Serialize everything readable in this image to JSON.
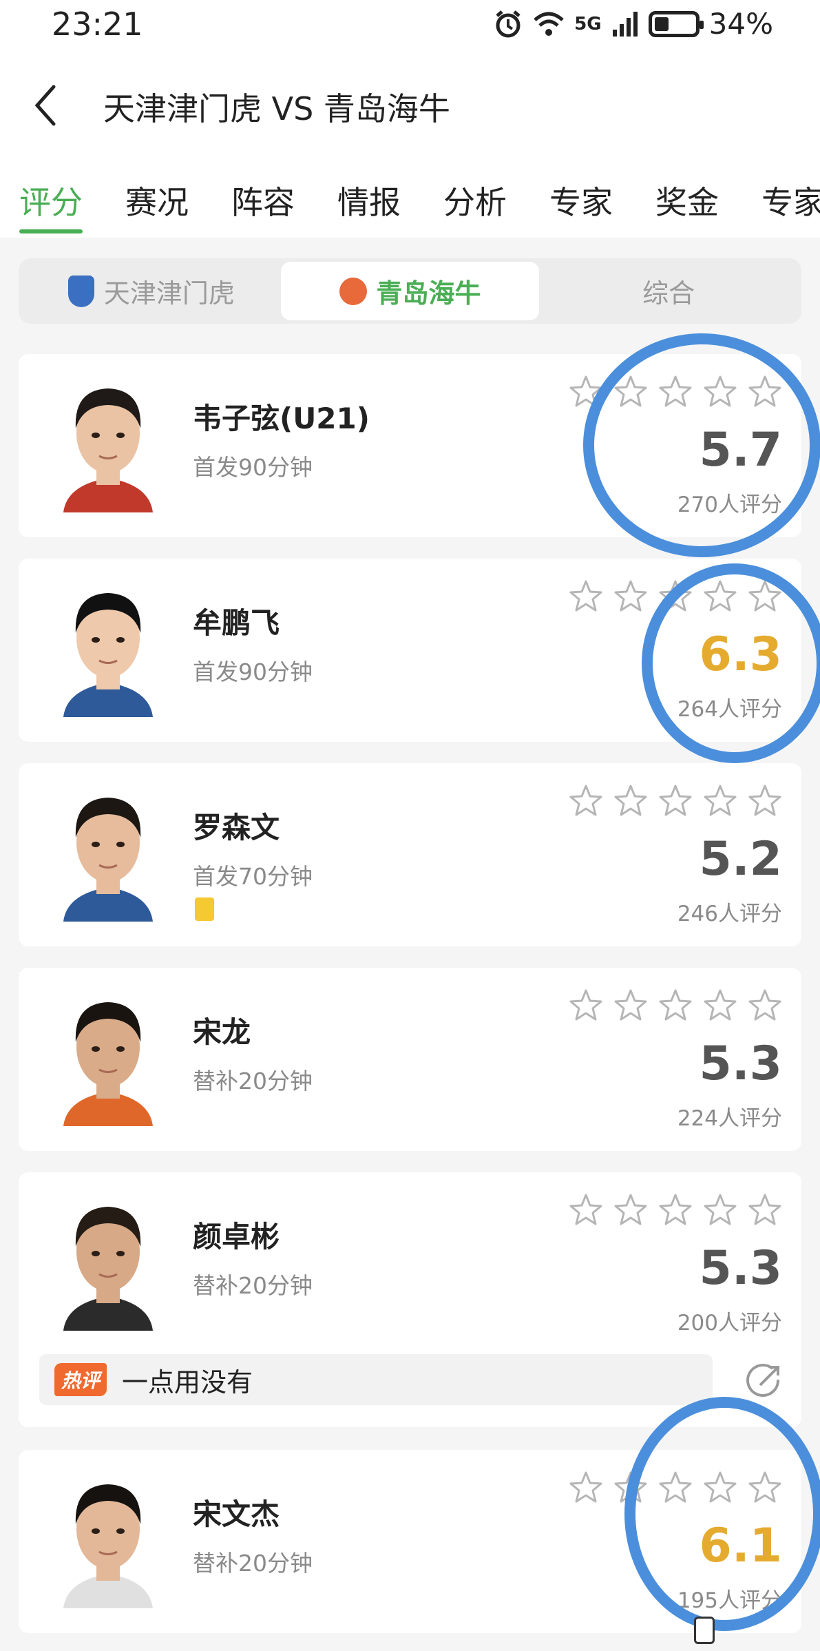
{
  "status_bar": {
    "time": "23:21",
    "network": "5G",
    "battery": "34%",
    "icons": [
      "alarm-icon",
      "wifi-icon",
      "signal-icon",
      "battery-icon"
    ]
  },
  "header": {
    "title": "天津津门虎 VS 青岛海牛",
    "back_icon": "chevron-left-icon"
  },
  "tabs": [
    {
      "label": "评分",
      "active": true
    },
    {
      "label": "赛况"
    },
    {
      "label": "阵容"
    },
    {
      "label": "情报"
    },
    {
      "label": "分析"
    },
    {
      "label": "专家"
    },
    {
      "label": "奖金"
    },
    {
      "label": "专家"
    }
  ],
  "segment": {
    "items": [
      {
        "label": "天津津门虎",
        "icon": "team-logo-icon"
      },
      {
        "label": "青岛海牛",
        "icon": "team-logo-icon",
        "active": true
      },
      {
        "label": "综合"
      }
    ]
  },
  "players": [
    {
      "name": "韦子弦(U21)",
      "sub": "首发90分钟",
      "score": "5.7",
      "raters": "270人评分",
      "stars": 0
    },
    {
      "name": "牟鹏飞",
      "sub": "首发90分钟",
      "score": "6.3",
      "raters": "264人评分",
      "stars": 0,
      "highlight": true
    },
    {
      "name": "罗森文",
      "sub": "首发70分钟",
      "score": "5.2",
      "raters": "246人评分",
      "stars": 0,
      "yellow_card": true
    },
    {
      "name": "宋龙",
      "sub": "替补20分钟",
      "score": "5.3",
      "raters": "224人评分",
      "stars": 0
    },
    {
      "name": "颜卓彬",
      "sub": "替补20分钟",
      "score": "5.3",
      "raters": "200人评分",
      "stars": 0,
      "hot_comment": {
        "tag": "热评",
        "text": "一点用没有"
      }
    },
    {
      "name": "宋文杰",
      "sub": "替补20分钟",
      "score": "6.1",
      "raters": "195人评分",
      "stars": 0,
      "highlight": true
    }
  ],
  "colors": {
    "accent": "#4aae55",
    "score_highlight": "#e5ab2f",
    "annotation_circle": "#4b8fdc",
    "hot_tag": "#f0692f"
  }
}
